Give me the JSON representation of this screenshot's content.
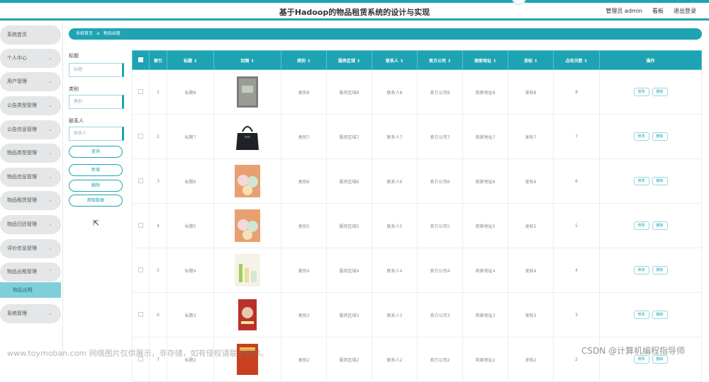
{
  "header": {
    "title": "基于Hadoop的物品租赁系统的设计与实现",
    "user": "管理员 admin",
    "board": "看板",
    "logout": "退出登录"
  },
  "sidebar": {
    "items": [
      {
        "label": "系统首页"
      },
      {
        "label": "个人中心"
      },
      {
        "label": "用户管理"
      },
      {
        "label": "公告类型管理"
      },
      {
        "label": "公告信息管理"
      },
      {
        "label": "物品类型管理"
      },
      {
        "label": "物品信息管理"
      },
      {
        "label": "物品租赁管理"
      },
      {
        "label": "物品归还管理"
      },
      {
        "label": "评价信息管理"
      },
      {
        "label": "物品出租管理"
      },
      {
        "label": "系统管理"
      }
    ],
    "active_sub": "物品出租"
  },
  "breadcrumb": {
    "home": "系统首页",
    "sep": "≡",
    "current": "物品出租"
  },
  "filters": {
    "title_label": "标题",
    "title_placeholder": "标题",
    "category_label": "类别",
    "category_placeholder": "类别",
    "contact_label": "联系人",
    "contact_placeholder": "联系人",
    "search": "查询",
    "add": "新增",
    "delete": "删除",
    "crawl": "爬取数据"
  },
  "table": {
    "headers": [
      "索引",
      "标题 ⇕",
      "封面 ⇕",
      "类别 ⇕",
      "服务区域 ⇕",
      "联系人 ⇕",
      "卖方公司 ⇕",
      "商家地址 ⇕",
      "发帖 ⇕",
      "点击次数 ⇕",
      "操作"
    ],
    "edit_label": "修改",
    "delete_label": "删除",
    "rows": [
      {
        "index": "1",
        "title": "标题8",
        "category": "类别8",
        "area": "服务区域8",
        "contact": "联系人8",
        "company": "卖方公司8",
        "address": "商家地址8",
        "post": "发帖8",
        "clicks": "8",
        "cover": "book-cover"
      },
      {
        "index": "2",
        "title": "标题7",
        "category": "类别7",
        "area": "服务区域7",
        "contact": "联系人7",
        "company": "卖方公司7",
        "address": "商家地址7",
        "post": "发帖7",
        "clicks": "7",
        "cover": "handbag"
      },
      {
        "index": "3",
        "title": "标题6",
        "category": "类别6",
        "area": "服务区域6",
        "contact": "联系人6",
        "company": "卖方公司6",
        "address": "商家地址6",
        "post": "发帖6",
        "clicks": "6",
        "cover": "plush-toys"
      },
      {
        "index": "4",
        "title": "标题5",
        "category": "类别5",
        "area": "服务区域5",
        "contact": "联系人5",
        "company": "卖方公司5",
        "address": "商家地址5",
        "post": "发帖5",
        "clicks": "5",
        "cover": "plush-toys"
      },
      {
        "index": "5",
        "title": "标题4",
        "category": "类别4",
        "area": "服务区域4",
        "contact": "联系人4",
        "company": "卖方公司4",
        "address": "商家地址4",
        "post": "发帖4",
        "clicks": "4",
        "cover": "cosmetics"
      },
      {
        "index": "6",
        "title": "标题3",
        "category": "类别3",
        "area": "服务区域3",
        "contact": "联系人3",
        "company": "卖方公司3",
        "address": "商家地址3",
        "post": "发帖3",
        "clicks": "3",
        "cover": "book-portrait"
      },
      {
        "index": "7",
        "title": "标题2",
        "category": "类别2",
        "area": "服务区域2",
        "contact": "联系人2",
        "company": "卖方公司2",
        "address": "商家地址2",
        "post": "发帖2",
        "clicks": "2",
        "cover": "book-red"
      }
    ]
  },
  "watermark": {
    "left": "www.toymoban.com 网络图片仅供展示，非存储，如有侵权请联系删除。",
    "right": "CSDN @计算机编程指导师"
  },
  "colors": {
    "accent": "#1ea3b3",
    "sidebar_bg": "#e4e6e7",
    "sub_active": "#7fcfda"
  }
}
